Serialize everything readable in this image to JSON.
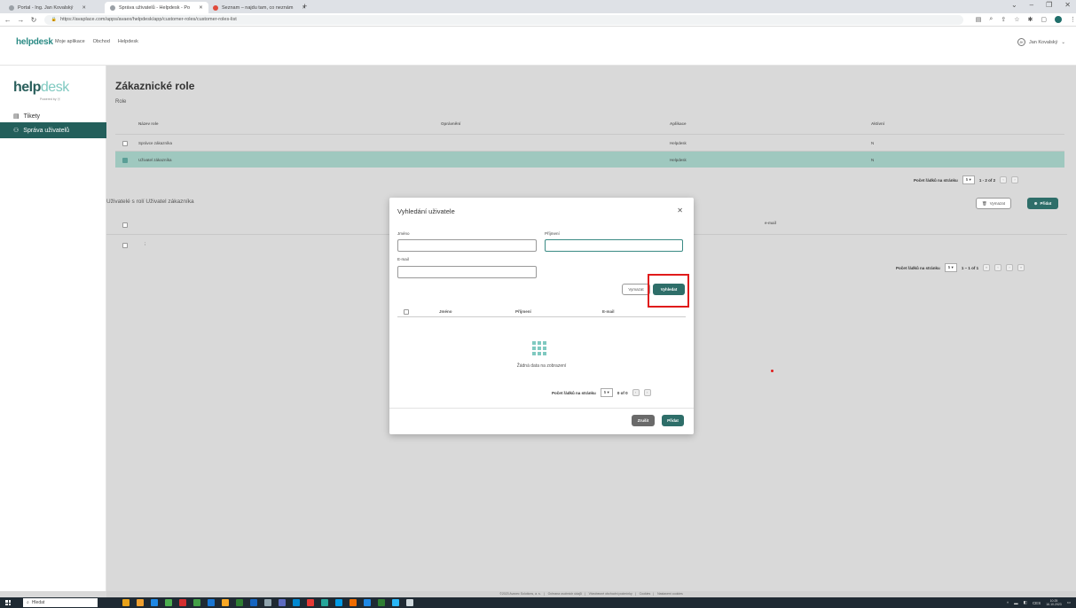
{
  "browser": {
    "tabs": [
      {
        "label": "Portal - Ing. Jan Kovalský"
      },
      {
        "label": "Správa uživatelů - Helpdesk - Po"
      },
      {
        "label": "Seznam – najdu tam, co neznám"
      }
    ],
    "url": "https://avaplace.com/apps/avaex/helpdesk/app/customer-roles/customer-roles-list"
  },
  "header": {
    "logo": "helpdesk",
    "nav": [
      "Moje aplikace",
      "Obchod",
      "Helpdesk"
    ],
    "user": "Jan Kovalský",
    "user_initials": "JK"
  },
  "sidebar": {
    "logo_main": "help",
    "logo_accent": "desk",
    "logo_sub": "Powered by ⓐ",
    "items": [
      {
        "label": "Tikety",
        "icon": "ticket-icon"
      },
      {
        "label": "Správa uživatelů",
        "icon": "users-icon"
      }
    ]
  },
  "main": {
    "title": "Zákaznické role",
    "roles_section": "Role",
    "roles_columns": [
      "Název role",
      "Oprávnění",
      "Aplikace",
      "Aktivní"
    ],
    "roles_rows": [
      {
        "name": "Správce zákazníka",
        "permission": "",
        "app": "Helpdesk",
        "active": "N",
        "selected": false
      },
      {
        "name": "Uživatel zákazníka",
        "permission": "",
        "app": "Helpdesk",
        "active": "N",
        "selected": true
      }
    ],
    "roles_pager": {
      "label": "Počet řádků na stránku",
      "per_page": "5",
      "range": "1 - 2 of 2"
    },
    "users_section": "Uživatelé s rolí Uživatel zákazníka",
    "users_email_col": "e-mail",
    "users_row_marker": "⋮",
    "users_pager": {
      "label": "Počet řádků na stránku",
      "per_page": "5",
      "range": "1 – 1 of 1"
    },
    "remove_label": "Vymazat",
    "add_label": "Přidat"
  },
  "modal": {
    "title": "Vyhledání uživatele",
    "first_name_label": "Jméno",
    "last_name_label": "Příjmení",
    "email_label": "E-mail",
    "clear_label": "Vymazat",
    "search_label": "Vyhledat",
    "columns": [
      "Jméno",
      "Příjmení",
      "E-mail"
    ],
    "empty_text": "Žádná data na zobrazení",
    "pager": {
      "label": "Počet řádků na stránku",
      "per_page": "5",
      "range": "0 of 0"
    },
    "cancel_label": "Zrušit",
    "add_label": "Přidat"
  },
  "footer": {
    "items": [
      "©2023 Avaxec Solutions, a. s.",
      "Ochrana osobních údajů",
      "Všeobecné obchodní podmínky",
      "Cookies",
      "Nastavení cookies"
    ]
  },
  "taskbar": {
    "search": "Hledat",
    "lang": "CES",
    "time": "10:25",
    "date": "16.10.2023"
  }
}
